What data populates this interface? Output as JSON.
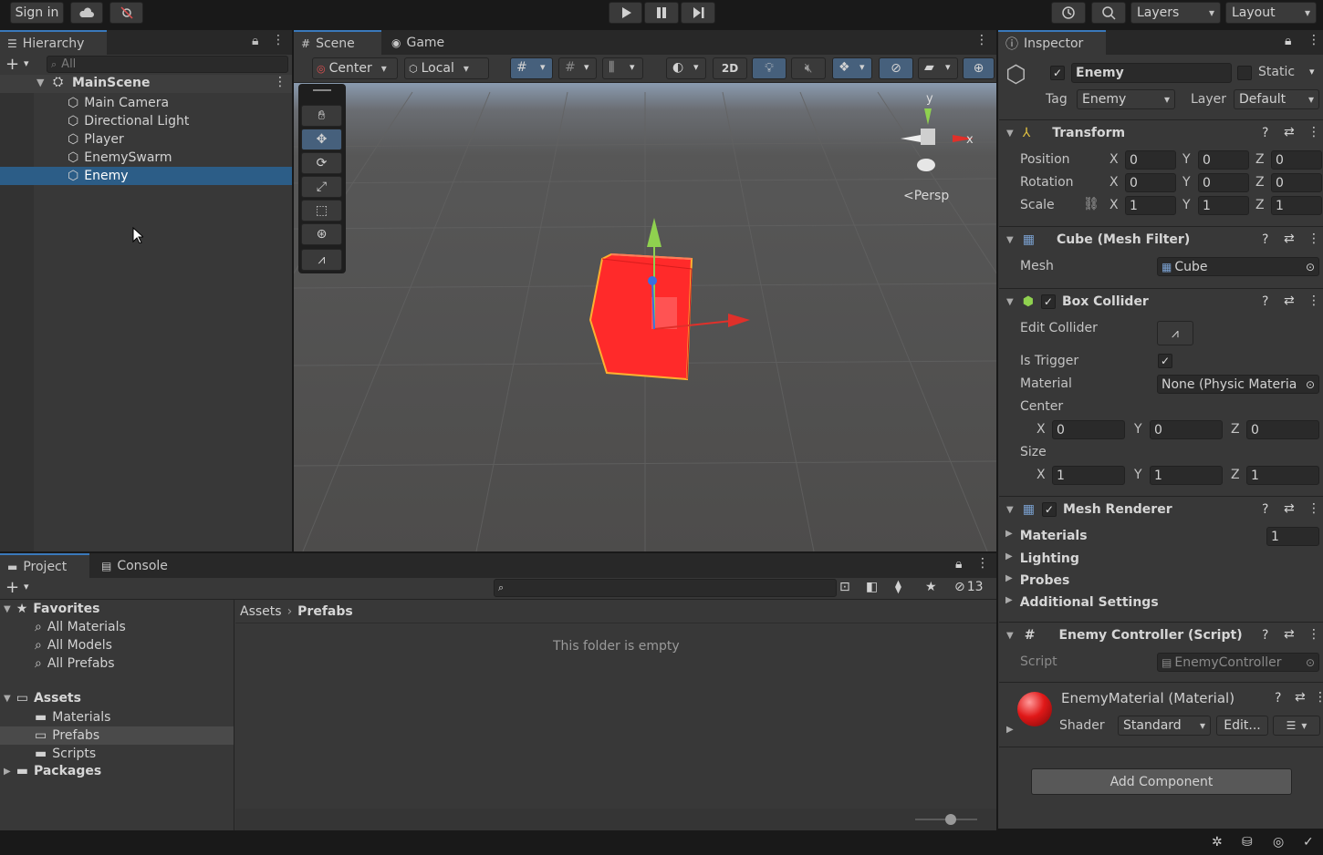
{
  "toolbar": {
    "signin": "Sign in",
    "layers": "Layers",
    "layout": "Layout"
  },
  "hierarchy": {
    "tab": "Hierarchy",
    "search_placeholder": "All",
    "scene": "MainScene",
    "items": [
      "Main Camera",
      "Directional Light",
      "Player",
      "EnemySwarm",
      "Enemy"
    ]
  },
  "scene": {
    "tab_scene": "Scene",
    "tab_game": "Game",
    "pivot": "Center",
    "space": "Local",
    "mode2d": "2D",
    "persp": "Persp",
    "gizmo_y": "y",
    "gizmo_x": "x"
  },
  "inspector": {
    "tab": "Inspector",
    "object_name": "Enemy",
    "static": "Static",
    "tag_label": "Tag",
    "tag": "Enemy",
    "layer_label": "Layer",
    "layer": "Default",
    "transform": {
      "title": "Transform",
      "position_label": "Position",
      "rotation_label": "Rotation",
      "scale_label": "Scale",
      "position": [
        "0",
        "0",
        "0"
      ],
      "rotation": [
        "0",
        "0",
        "0"
      ],
      "scale": [
        "1",
        "1",
        "1"
      ],
      "axes": [
        "X",
        "Y",
        "Z"
      ]
    },
    "mesh_filter": {
      "title": "Cube (Mesh Filter)",
      "mesh_label": "Mesh",
      "mesh": "Cube"
    },
    "box_collider": {
      "title": "Box Collider",
      "edit_label": "Edit Collider",
      "trigger_label": "Is Trigger",
      "material_label": "Material",
      "material": "None (Physic Materia",
      "center_label": "Center",
      "center": [
        "0",
        "0",
        "0"
      ],
      "size_label": "Size",
      "size": [
        "1",
        "1",
        "1"
      ]
    },
    "mesh_renderer": {
      "title": "Mesh Renderer",
      "materials_label": "Materials",
      "materials_count": "1",
      "lighting": "Lighting",
      "probes": "Probes",
      "additional": "Additional Settings"
    },
    "script": {
      "title": "Enemy Controller (Script)",
      "script_label": "Script",
      "script": "EnemyController"
    },
    "material": {
      "title": "EnemyMaterial (Material)",
      "shader_label": "Shader",
      "shader": "Standard",
      "edit": "Edit..."
    },
    "add_component": "Add Component"
  },
  "project": {
    "tab_project": "Project",
    "tab_console": "Console",
    "hidden_count": "13",
    "favorites": "Favorites",
    "fav_items": [
      "All Materials",
      "All Models",
      "All Prefabs"
    ],
    "assets": "Assets",
    "asset_folders": [
      "Materials",
      "Prefabs",
      "Scripts"
    ],
    "packages": "Packages",
    "breadcrumb_root": "Assets",
    "breadcrumb_current": "Prefabs",
    "empty": "This folder is empty"
  },
  "colors": {
    "accent": "#2c5d87",
    "selection": "#2c5d87",
    "cube": "#ff2a2a"
  }
}
